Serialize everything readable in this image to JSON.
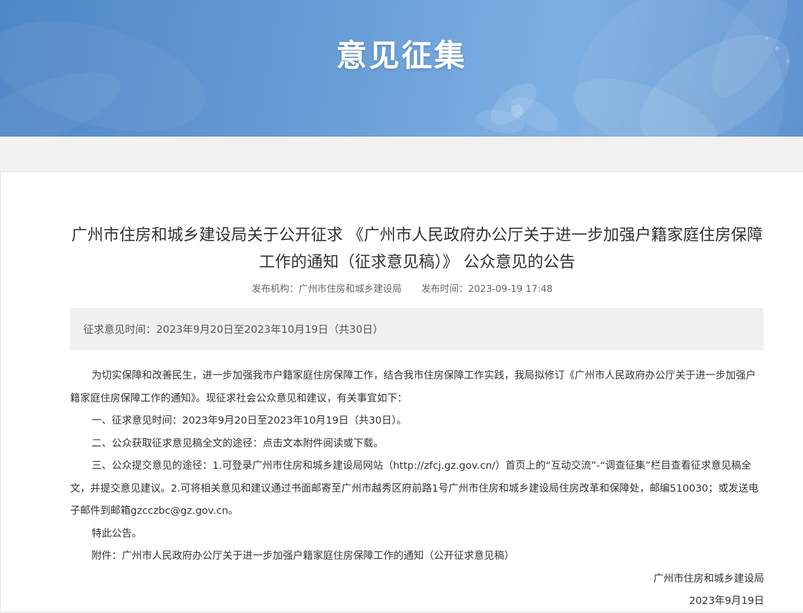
{
  "banner": {
    "title": "意见征集"
  },
  "article": {
    "title": "广州市住房和城乡建设局关于公开征求 《广州市人民政府办公厅关于进一步加强户籍家庭住房保障工作的通知（征求意见稿）》 公众意见的公告",
    "publisher": "发布机构：广州市住房和城乡建设局",
    "publish_time": "发布时间：2023-09-19 17:48",
    "period": "征求意见时间：2023年9月20日至2023年10月19日（共30日）",
    "paragraphs": [
      "为切实保障和改善民生，进一步加强我市户籍家庭住房保障工作，结合我市住房保障工作实践，我局拟修订《广州市人民政府办公厅关于进一步加强户籍家庭住房保障工作的通知》。现征求社会公众意见和建议，有关事宜如下：",
      "一、征求意见时间：2023年9月20日至2023年10月19日（共30日）。",
      "二、公众获取征求意见稿全文的途径：点击文本附件阅读或下载。",
      "三、公众提交意见的途径：1.可登录广州市住房和城乡建设局网站（http://zfcj.gz.gov.cn/）首页上的“互动交流”-“调查征集”栏目查看征求意见稿全文，并提交意见建议。2.可将相关意见和建议通过书面邮寄至广州市越秀区府前路1号广州市住房和城乡建设局住房改革和保障处，邮编510030；或发送电子邮件到邮箱gzcczbc@gz.gov.cn。",
      "特此公告。",
      "附件：广州市人民政府办公厅关于进一步加强户籍家庭住房保障工作的通知（公开征求意见稿）"
    ],
    "signature": "广州市住房和城乡建设局",
    "date": "2023年9月19日"
  }
}
